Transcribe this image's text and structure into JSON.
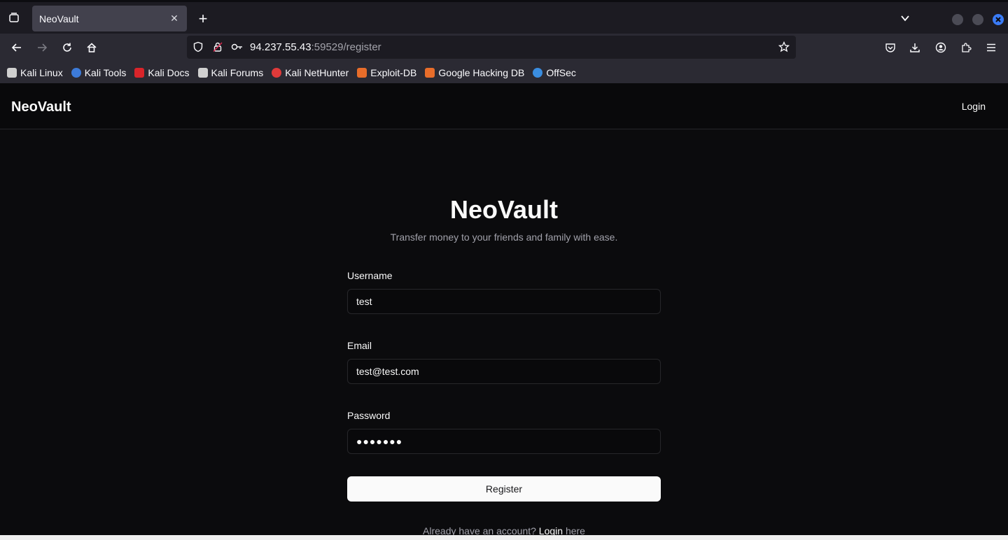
{
  "browser": {
    "tab": {
      "title": "NeoVault",
      "close_glyph": "✕"
    },
    "new_tab_glyph": "+",
    "url": {
      "host": "94.237.55.43",
      "rest": ":59529/register"
    },
    "bookmarks": [
      {
        "label": "Kali Linux",
        "icon": "kali-dragon-icon",
        "color": "#d0d0d0"
      },
      {
        "label": "Kali Tools",
        "icon": "kali-tools-icon",
        "color": "#3d7bd9"
      },
      {
        "label": "Kali Docs",
        "icon": "kali-docs-icon",
        "color": "#d9242a"
      },
      {
        "label": "Kali Forums",
        "icon": "kali-forums-icon",
        "color": "#d0d0d0"
      },
      {
        "label": "Kali NetHunter",
        "icon": "kali-nethunter-icon",
        "color": "#e03a3a"
      },
      {
        "label": "Exploit-DB",
        "icon": "exploit-db-icon",
        "color": "#e86d2a"
      },
      {
        "label": "Google Hacking DB",
        "icon": "ghdb-icon",
        "color": "#e86d2a"
      },
      {
        "label": "OffSec",
        "icon": "offsec-icon",
        "color": "#3a8de0"
      }
    ]
  },
  "site": {
    "brand": "NeoVault",
    "nav_login": "Login",
    "hero_title": "NeoVault",
    "hero_subtitle": "Transfer money to your friends and family with ease.",
    "form": {
      "username_label": "Username",
      "username_value": "test",
      "email_label": "Email",
      "email_value": "test@test.com",
      "password_label": "Password",
      "password_value": "●●●●●●●",
      "submit_label": "Register"
    },
    "footer": {
      "prefix": "Already have an account? ",
      "link": "Login",
      "suffix": " here"
    }
  }
}
